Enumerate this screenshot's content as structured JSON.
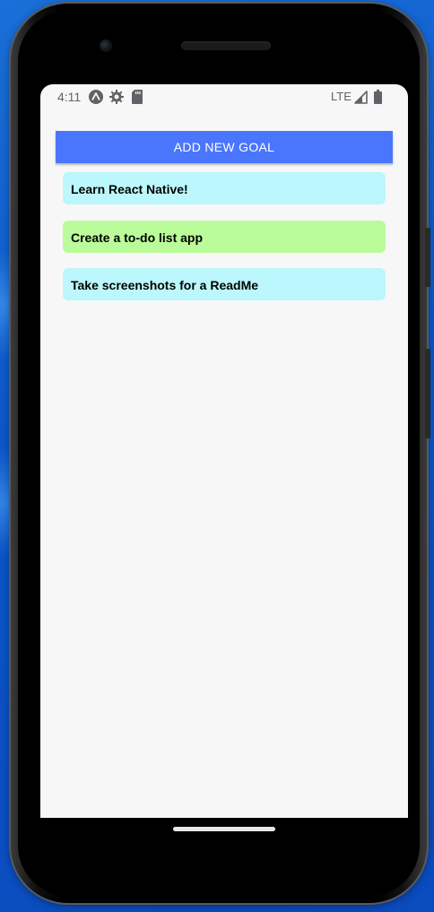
{
  "status_bar": {
    "time": "4:11",
    "icons_left": [
      "expo-icon",
      "settings-icon",
      "sd-card-icon"
    ],
    "network": "LTE",
    "icons_right": [
      "signal-icon",
      "battery-icon"
    ]
  },
  "app": {
    "add_button_label": "ADD NEW GOAL",
    "goals": [
      {
        "text": "Learn React Native!",
        "color": "#bbf7fc"
      },
      {
        "text": "Create a to-do list app",
        "color": "#bafc9a"
      },
      {
        "text": "Take screenshots for a ReadMe",
        "color": "#bbf7fc"
      }
    ]
  },
  "colors": {
    "button": "#4a76fd",
    "screen_background": "#f7f7f7",
    "desktop_background": "#0b55c9"
  }
}
